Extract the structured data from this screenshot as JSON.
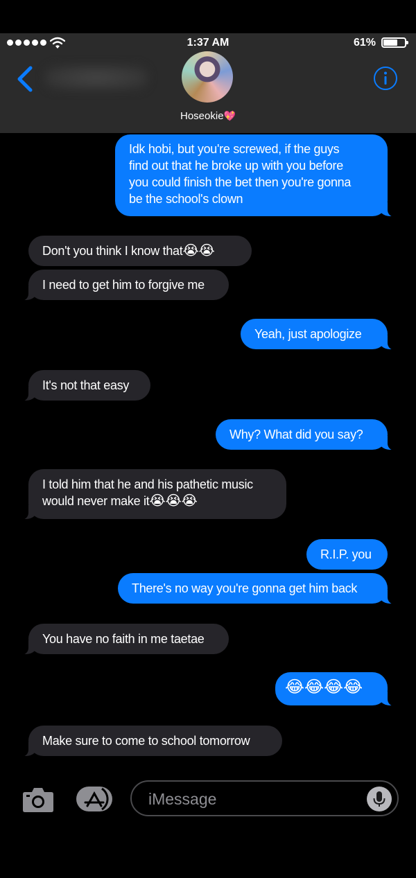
{
  "status_bar": {
    "time": "1:37 AM",
    "battery": "61%",
    "icons": [
      "signal-dots-icon",
      "wifi-icon",
      "battery-icon"
    ]
  },
  "nav": {
    "back_icon": "chevron-left-icon",
    "info_icon": "info-icon",
    "contact_name": "Hoseokie",
    "contact_emoji": "💖",
    "accent": "#0a7cff"
  },
  "colors": {
    "sent_bubble": "#0a7cff",
    "received_bubble": "#26252a",
    "background": "#000000",
    "header": "#2b2b2b"
  },
  "messages": [
    {
      "from": "me",
      "lines": [
        "Idk hobi, but you're screwed, if the guys",
        "find out that he broke up with you before",
        "you could finish the bet then you're gonna",
        "be the school's clown"
      ]
    },
    {
      "from": "them",
      "text": "Don't you think I know that",
      "emoji": "😭😭"
    },
    {
      "from": "them",
      "text": "I need to get him to forgive me"
    },
    {
      "from": "me",
      "text": "Yeah, just apologize"
    },
    {
      "from": "them",
      "text": "It's not that easy"
    },
    {
      "from": "me",
      "text": "Why? What did you say?"
    },
    {
      "from": "them",
      "lines": [
        "I told him that he and his pathetic music",
        "would never make it"
      ],
      "emoji": "😭😭😭"
    },
    {
      "from": "me",
      "text": "R.I.P. you"
    },
    {
      "from": "me",
      "text": "There's no way you're gonna get him back"
    },
    {
      "from": "them",
      "text": "You have no faith in me taetae"
    },
    {
      "from": "me",
      "emoji": "😂😂😂😂"
    },
    {
      "from": "them",
      "text": "Make sure to come to school tomorrow"
    }
  ],
  "input_bar": {
    "camera_icon": "camera-icon",
    "apps_icon": "app-store-icon",
    "placeholder": "iMessage",
    "mic_icon": "microphone-icon"
  }
}
